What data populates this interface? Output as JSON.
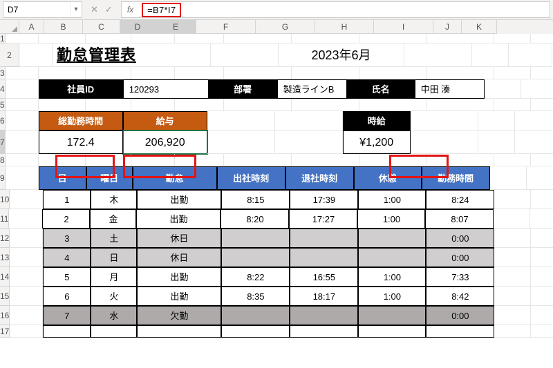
{
  "formula_bar": {
    "cell_ref": "D7",
    "formula": "=B7*I7"
  },
  "columns": [
    "A",
    "B",
    "C",
    "D",
    "E",
    "F",
    "G",
    "H",
    "I",
    "J",
    "K"
  ],
  "rows": [
    "1",
    "2",
    "3",
    "4",
    "5",
    "6",
    "7",
    "8",
    "9",
    "10",
    "11",
    "12",
    "13",
    "14",
    "15",
    "16",
    "17"
  ],
  "title": "勤怠管理表",
  "period": "2023年6月",
  "labels": {
    "emp_id": "社員ID",
    "dept": "部署",
    "name_lbl": "氏名",
    "total_hours": "総勤務時間",
    "salary": "給与",
    "rate": "時給",
    "day": "日",
    "dow": "曜日",
    "status": "勤怠",
    "in": "出社時刻",
    "out": "退社時刻",
    "break": "休憩",
    "work": "勤務時間"
  },
  "emp": {
    "id": "120293",
    "dept": "製造ラインB",
    "name": "中田 湊"
  },
  "summary": {
    "total_hours": "172.4",
    "salary": "206,920",
    "rate": "¥1,200"
  },
  "days": [
    {
      "d": "1",
      "dow": "木",
      "st": "出勤",
      "in": "8:15",
      "out": "17:39",
      "br": "1:00",
      "wk": "8:24",
      "cls": ""
    },
    {
      "d": "2",
      "dow": "金",
      "st": "出勤",
      "in": "8:20",
      "out": "17:27",
      "br": "1:00",
      "wk": "8:07",
      "cls": ""
    },
    {
      "d": "3",
      "dow": "土",
      "st": "休日",
      "in": "",
      "out": "",
      "br": "",
      "wk": "0:00",
      "cls": "gray"
    },
    {
      "d": "4",
      "dow": "日",
      "st": "休日",
      "in": "",
      "out": "",
      "br": "",
      "wk": "0:00",
      "cls": "gray"
    },
    {
      "d": "5",
      "dow": "月",
      "st": "出勤",
      "in": "8:22",
      "out": "16:55",
      "br": "1:00",
      "wk": "7:33",
      "cls": ""
    },
    {
      "d": "6",
      "dow": "火",
      "st": "出勤",
      "in": "8:35",
      "out": "18:17",
      "br": "1:00",
      "wk": "8:42",
      "cls": ""
    },
    {
      "d": "7",
      "dow": "水",
      "st": "欠勤",
      "in": "",
      "out": "",
      "br": "",
      "wk": "0:00",
      "cls": "dgray"
    }
  ],
  "active_col_letters": [
    "D",
    "E"
  ]
}
